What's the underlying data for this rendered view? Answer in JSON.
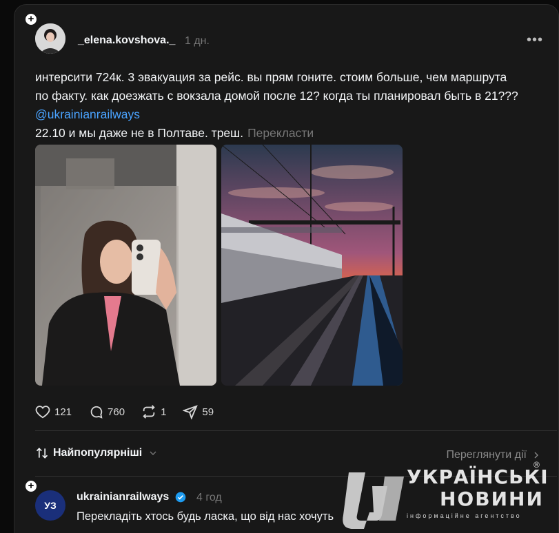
{
  "post": {
    "username": "_elena.kovshova._",
    "time": "1 дн.",
    "text_line1": "интерсити 724к. 3 эвакуация за рейс. вы прям гоните. стоим больше, чем маршрута",
    "text_line2": "по факту. как доезжать с вокзала домой после 12? когда ты планировал быть в 21???",
    "mention": "@ukrainianrailways",
    "text_line4": "22.10 и мы даже не в Полтаве. треш.",
    "translate_label": "Перекласти"
  },
  "actions": {
    "likes": "121",
    "comments": "760",
    "reposts": "1",
    "shares": "59"
  },
  "sort": {
    "label": "Найпопулярніші"
  },
  "view_activity": "Переглянути дії",
  "reply": {
    "username": "ukrainianrailways",
    "time": "4 год",
    "text": "Перекладіть хтось будь ласка, що від нас хочуть",
    "avatar_text": "УЗ"
  },
  "watermark": {
    "line1": "УКРАЇНСЬКІ",
    "line2": "НОВИНИ",
    "line3": "інформаційне агентство",
    "registered": "®"
  },
  "icons": [
    "more-icon",
    "heart-icon",
    "comment-icon",
    "repost-icon",
    "share-icon",
    "sort-icon",
    "chevron-down-icon",
    "chevron-right-icon",
    "verified-icon",
    "plus-icon"
  ]
}
